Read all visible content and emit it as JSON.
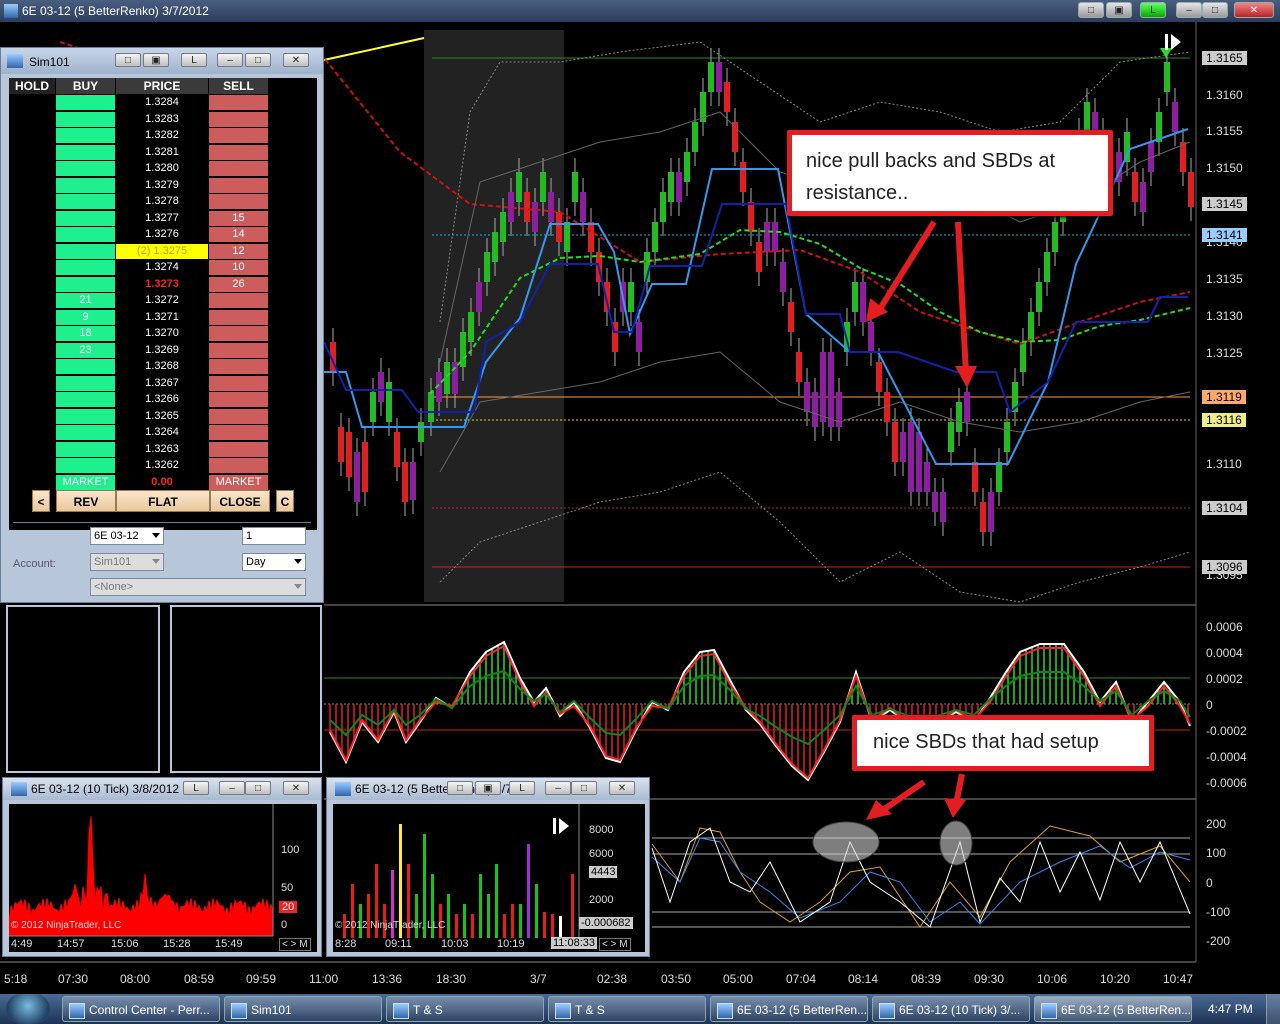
{
  "main_window": {
    "title": "6E 03-12 (5 BetterRenko)  3/7/2012",
    "buttons": [
      "□",
      "▣",
      "L",
      "–",
      "□",
      "✕"
    ]
  },
  "price_axis": {
    "labels": [
      "1.3160",
      "1.3155",
      "1.3150",
      "1.3145",
      "1.3140",
      "1.3135",
      "1.3130",
      "1.3125",
      "1.3120",
      "1.3115",
      "1.3110",
      "1.3105",
      "1.3100",
      "1.3095"
    ],
    "tags": [
      "1.3165",
      "1.3145",
      "1.3141",
      "1.3119",
      "1.3116",
      "1.3104",
      "1.3096"
    ]
  },
  "osc1_axis": [
    "0.0006",
    "0.0004",
    "0.0002",
    "0",
    "-0.0002",
    "-0.0004",
    "-0.0006"
  ],
  "osc2_axis": [
    "200",
    "100",
    "0",
    "-100",
    "-200"
  ],
  "time_axis": [
    "5:18",
    "07:30",
    "08:00",
    "08:59",
    "09:59",
    "11:00",
    "13:36",
    "18:30",
    "3/7",
    "02:38",
    "03:50",
    "05:00",
    "07:04",
    "08:14",
    "08:39",
    "09:30",
    "10:06",
    "10:20",
    "10:47"
  ],
  "callouts": {
    "top": "nice pull backs and SBDs at resistance..",
    "bottom": "nice SBDs that had setup"
  },
  "sim": {
    "title": "Sim101",
    "headers": {
      "hold": "HOLD",
      "buy": "BUY",
      "price": "PRICE",
      "sell": "SELL"
    },
    "rows": [
      {
        "buy": "",
        "price": "1.3284",
        "sell": ""
      },
      {
        "buy": "",
        "price": "1.3283",
        "sell": ""
      },
      {
        "buy": "",
        "price": "1.3282",
        "sell": ""
      },
      {
        "buy": "",
        "price": "1.3281",
        "sell": ""
      },
      {
        "buy": "",
        "price": "1.3280",
        "sell": ""
      },
      {
        "buy": "",
        "price": "1.3279",
        "sell": ""
      },
      {
        "buy": "",
        "price": "1.3278",
        "sell": ""
      },
      {
        "buy": "",
        "price": "1.3277",
        "sell": "15"
      },
      {
        "buy": "",
        "price": "1.3276",
        "sell": "14"
      },
      {
        "buy": "",
        "price": "(2) 1.3275",
        "sell": "12"
      },
      {
        "buy": "",
        "price": "1.3274",
        "sell": "10"
      },
      {
        "buy": "",
        "price": "1.3273",
        "sell": "26"
      },
      {
        "buy": "21",
        "price": "1.3272",
        "sell": ""
      },
      {
        "buy": "9",
        "price": "1.3271",
        "sell": ""
      },
      {
        "buy": "18",
        "price": "1.3270",
        "sell": ""
      },
      {
        "buy": "23",
        "price": "1.3269",
        "sell": ""
      },
      {
        "buy": "",
        "price": "1.3268",
        "sell": ""
      },
      {
        "buy": "",
        "price": "1.3267",
        "sell": ""
      },
      {
        "buy": "",
        "price": "1.3266",
        "sell": ""
      },
      {
        "buy": "",
        "price": "1.3265",
        "sell": ""
      },
      {
        "buy": "",
        "price": "1.3264",
        "sell": ""
      },
      {
        "buy": "",
        "price": "1.3263",
        "sell": ""
      },
      {
        "buy": "",
        "price": "1.3262",
        "sell": ""
      }
    ],
    "market_row": {
      "buy": "MARKET",
      "price": "0.00",
      "sell": "MARKET"
    },
    "buttons": {
      "left": "<",
      "rev": "REV",
      "flat": "FLAT",
      "close": "CLOSE",
      "right": "C"
    },
    "instrument": "6E 03-12",
    "quantity": "1",
    "account_label": "Account:",
    "account": "Sim101",
    "tif": "Day",
    "atm": "<None>"
  },
  "tick_window": {
    "title": "6E 03-12 (10 Tick)  3/8/2012",
    "axis": [
      "100",
      "50",
      "20",
      "0"
    ],
    "time": [
      "4:49",
      "14:57",
      "15:06",
      "15:28",
      "15:49"
    ],
    "copyright": "© 2012 NinjaTrader, LLC",
    "nav": "< > M"
  },
  "renko_window": {
    "title": "6E 03-12 (5 BetterRenko)  3/7",
    "axis": [
      "8000",
      "6000",
      "4443",
      "2000",
      "-0.000682"
    ],
    "time": [
      "8:28",
      "09:11",
      "10:03",
      "10:19",
      "11:08:33"
    ],
    "copyright": "© 2012 NinjaTrader, LLC",
    "nav": "< > M"
  },
  "taskbar": {
    "items": [
      "Control Center - Perr...",
      "Sim101",
      "T & S",
      "T & S",
      "6E 03-12 (5 BetterRen...",
      "6E 03-12 (10 Tick)  3/...",
      "6E 03-12 (5 BetterRen..."
    ],
    "clock": "4:47 PM"
  },
  "colors": {
    "up": "#22c022",
    "down": "#ff1a1a",
    "purple": "#8b1fa0",
    "band": "#4499ee",
    "buy_cell": "#1df08c",
    "sell_cell": "#cd5c5c"
  }
}
